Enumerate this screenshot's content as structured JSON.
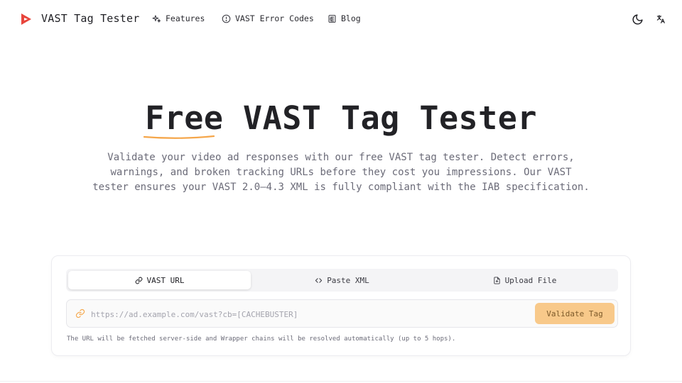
{
  "colors": {
    "accent": "#f5a64a",
    "logo": "#e8453c",
    "button_bg": "#f8c98a",
    "text_muted": "#6b6b78"
  },
  "nav": {
    "brand": "VAST Tag Tester",
    "links": [
      {
        "label": "Features",
        "icon": "sparkles-icon"
      },
      {
        "label": "VAST Error Codes",
        "icon": "alert-circle-icon"
      },
      {
        "label": "Blog",
        "icon": "newspaper-icon"
      }
    ],
    "theme_icon": "moon-icon",
    "language_icon": "translate-icon"
  },
  "hero": {
    "title_highlight": "Free",
    "title_rest": " VAST Tag Tester",
    "subtitle": "Validate your video ad responses with our free VAST tag tester. Detect errors, warnings, and broken tracking URLs before they cost you impressions. Our VAST tester ensures your VAST 2.0–4.3 XML is fully compliant with the IAB specification."
  },
  "tester": {
    "tabs": [
      {
        "label": "VAST URL",
        "icon": "link-icon",
        "active": true
      },
      {
        "label": "Paste XML",
        "icon": "code-icon",
        "active": false
      },
      {
        "label": "Upload File",
        "icon": "file-icon",
        "active": false
      }
    ],
    "url_placeholder": "https://ad.example.com/vast?cb=[CACHEBUSTER]",
    "url_value": "",
    "validate_label": "Validate Tag",
    "hint": "The URL will be fetched server-side and Wrapper chains will be resolved automatically (up to 5 hops)."
  }
}
